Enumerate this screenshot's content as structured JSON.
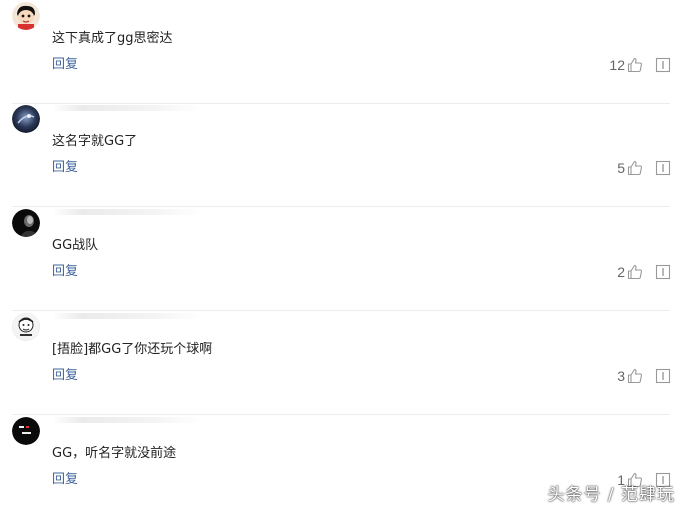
{
  "comments": [
    {
      "text": "这下真成了gg思密达",
      "reply_label": "回复",
      "likes": "12",
      "avatar_icon": "cartoon-boy-avatar-icon"
    },
    {
      "text": "这名字就GG了",
      "reply_label": "回复",
      "likes": "5",
      "avatar_icon": "dark-space-avatar-icon"
    },
    {
      "text": "GG战队",
      "reply_label": "回复",
      "likes": "2",
      "avatar_icon": "dark-portrait-avatar-icon"
    },
    {
      "text": "[捂脸]都GG了你还玩个球啊",
      "reply_label": "回复",
      "likes": "3",
      "avatar_icon": "meme-face-avatar-icon"
    },
    {
      "text": "GG，听名字就没前途",
      "reply_label": "回复",
      "likes": "1",
      "avatar_icon": "black-text-avatar-icon"
    }
  ],
  "watermark": "头条号 / 范肆玩",
  "colors": {
    "reply_link": "#406599",
    "text": "#222222",
    "count": "#666666",
    "divider": "#ececec"
  }
}
